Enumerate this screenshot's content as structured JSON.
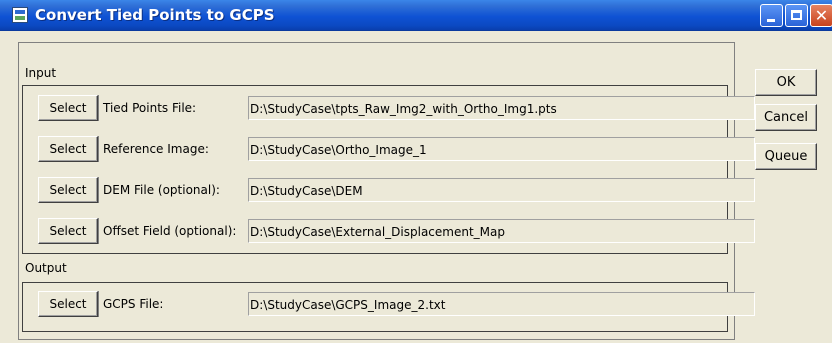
{
  "window": {
    "title": "Convert Tied Points to GCPS",
    "controls": {
      "minimize": "minimize-icon",
      "maximize": "maximize-icon",
      "close": "close-icon"
    }
  },
  "input_section": {
    "label": "Input",
    "rows": [
      {
        "button": "Select",
        "label": "Tied Points File:",
        "value": "D:\\StudyCase\\tpts_Raw_Img2_with_Ortho_Img1.pts"
      },
      {
        "button": "Select",
        "label": "Reference Image:",
        "value": "D:\\StudyCase\\Ortho_Image_1"
      },
      {
        "button": "Select",
        "label": "DEM File (optional):",
        "value": "D:\\StudyCase\\DEM"
      },
      {
        "button": "Select",
        "label": "Offset Field (optional):",
        "value": "D:\\StudyCase\\External_Displacement_Map"
      }
    ]
  },
  "output_section": {
    "label": "Output",
    "rows": [
      {
        "button": "Select",
        "label": "GCPS File:",
        "value": "D:\\StudyCase\\GCPS_Image_2.txt"
      }
    ]
  },
  "buttons": {
    "ok": "OK",
    "cancel": "Cancel",
    "queue": "Queue"
  },
  "colors": {
    "titlebar": "#0f52d4",
    "dialog_bg": "#ece9d8",
    "close_button": "#c8421c"
  }
}
